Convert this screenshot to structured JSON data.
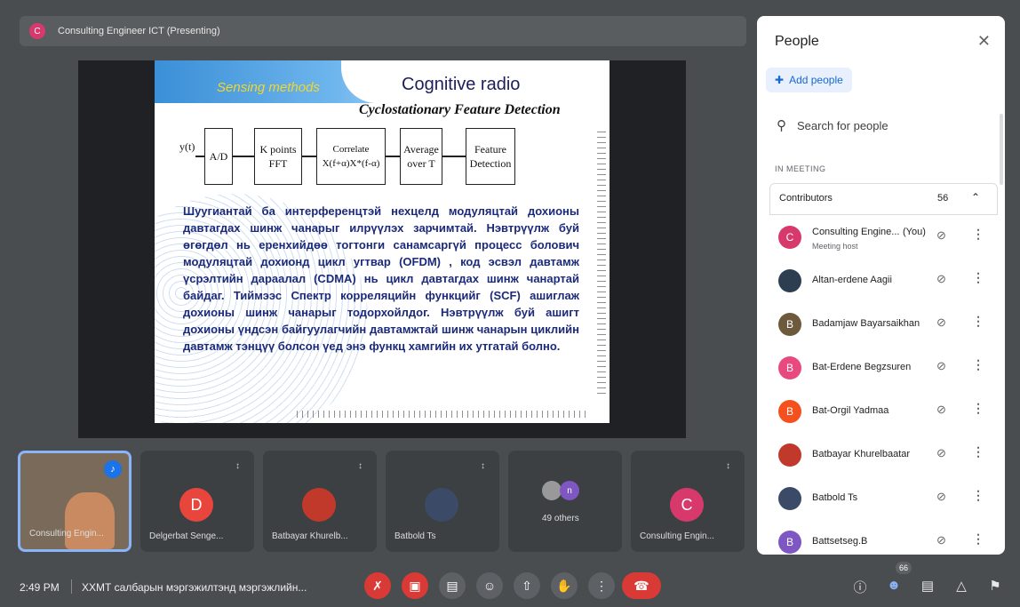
{
  "topbar": {
    "avatar_letter": "C",
    "presenter": "Consulting Engineer ICT (Presenting)"
  },
  "slide": {
    "sensing": "Sensing methods",
    "title": "Cognitive radio",
    "subtitle": "Cyclostationary Feature Detection",
    "input_label": "y(t)",
    "blocks": [
      "A/D",
      "K points\nFFT",
      "Correlate\nX(f+α)X*(f-α)",
      "Average\nover T",
      "Feature\nDetection"
    ],
    "body": "Шуугиантай ба интерференцтэй нехцелд модуляцтай дохионы давтагдах шинж чанарыг илрүүлэх зарчимтай. Нэвтрүүлж буй өгөгдөл нь еренхийдөө тогтонги санамсаргүй процесс болович модуляцтай дохионд цикл угтвар (OFDM) , код эсвэл давтамж үсрэлтийн дараалал (CDMA) нь цикл давтагдах шинж чанартай байдаг. Тиймээс Спектр корреляцийн функцийг (SCF) ашиглаж дохионы шинж чанарыг тодорхойлдог. Нэвтрүүлж буй ашигт дохионы үндсэн байгуулагчийн давтамжтай шинж чанарын циклийн давтамж тэнцүү болсон үед энэ функц хамгийн их утгатай болно."
  },
  "tiles": [
    {
      "name": "Consulting Engin...",
      "type": "self"
    },
    {
      "name": "Delgerbat Senge...",
      "letter": "D",
      "color": "#e8453c"
    },
    {
      "name": "Batbayar Khurelb...",
      "letter": "",
      "color": "#c0392b"
    },
    {
      "name": "Batbold Ts",
      "letter": "",
      "color": "#3b4a66"
    },
    {
      "name": "49 others",
      "letter": "n",
      "color": "#7e57c2"
    },
    {
      "name": "Consulting Engin...",
      "letter": "C",
      "color": "#d8396c"
    }
  ],
  "bottombar": {
    "time": "2:49 PM",
    "meeting_title": "ХХМТ салбарын мэргэжилтэнд мэргэжлийн...",
    "people_badge": "66"
  },
  "panel": {
    "title": "People",
    "add_label": "Add people",
    "search_placeholder": "Search for people",
    "section": "IN MEETING",
    "group_label": "Contributors",
    "group_count": "56",
    "people": [
      {
        "name": "Consulting Engine...",
        "you": "(You)",
        "sub": "Meeting host",
        "letter": "C",
        "color": "#d8396c"
      },
      {
        "name": "Altan-erdene Aagii",
        "letter": "",
        "color": "#2c3e50"
      },
      {
        "name": "Badamjaw Bayarsaikhan",
        "letter": "B",
        "color": "#6d5a3c"
      },
      {
        "name": "Bat-Erdene Begzsuren",
        "letter": "B",
        "color": "#e84a7f"
      },
      {
        "name": "Bat-Orgil Yadmaa",
        "letter": "B",
        "color": "#f4511e"
      },
      {
        "name": "Batbayar Khurelbaatar",
        "letter": "",
        "color": "#c0392b"
      },
      {
        "name": "Batbold Ts",
        "letter": "",
        "color": "#3b4a66"
      },
      {
        "name": "Battsetseg.B",
        "letter": "B",
        "color": "#7e57c2"
      }
    ]
  }
}
